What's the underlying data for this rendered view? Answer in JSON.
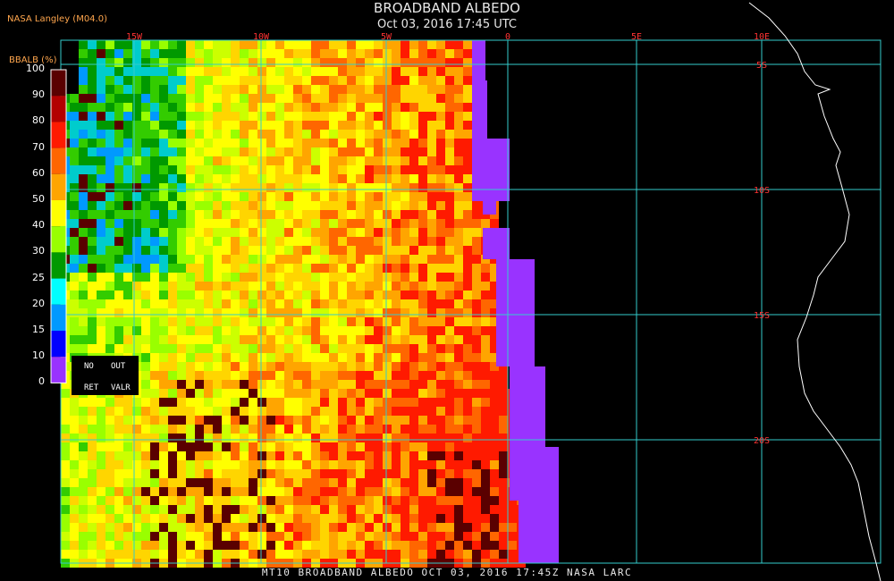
{
  "header": {
    "title": "BROADBAND ALBEDO",
    "datetime": "Oct 03, 2016 17:45 UTC",
    "source": "NASA Langley (M04.0)"
  },
  "legend": {
    "title": "BBALB (%)",
    "ticks": [
      "100",
      "90",
      "80",
      "70",
      "60",
      "50",
      "40",
      "30",
      "25",
      "20",
      "15",
      "10",
      "0"
    ],
    "colors": [
      "#5a0000",
      "#b30000",
      "#ff1a00",
      "#ff6600",
      "#ffa500",
      "#ffff00",
      "#99ff00",
      "#009900",
      "#00ffff",
      "#0099ff",
      "#0000ff",
      "#9933ff"
    ],
    "no_ret_labels": [
      "NO",
      "OUT",
      "RET",
      "VALR"
    ]
  },
  "map": {
    "lon_labels": [
      "15W",
      "10W",
      "5W",
      "0",
      "5E",
      "10E"
    ],
    "lat_labels": [
      "5S",
      "10S",
      "15S",
      "20S"
    ],
    "grid_color": "#33cccc",
    "label_color": "#ff3333",
    "nodata_color": "#9933ff"
  },
  "footer": "MT10  BROADBAND ALBEDO   OCT 03, 2016 17:45Z   NASA LARC"
}
